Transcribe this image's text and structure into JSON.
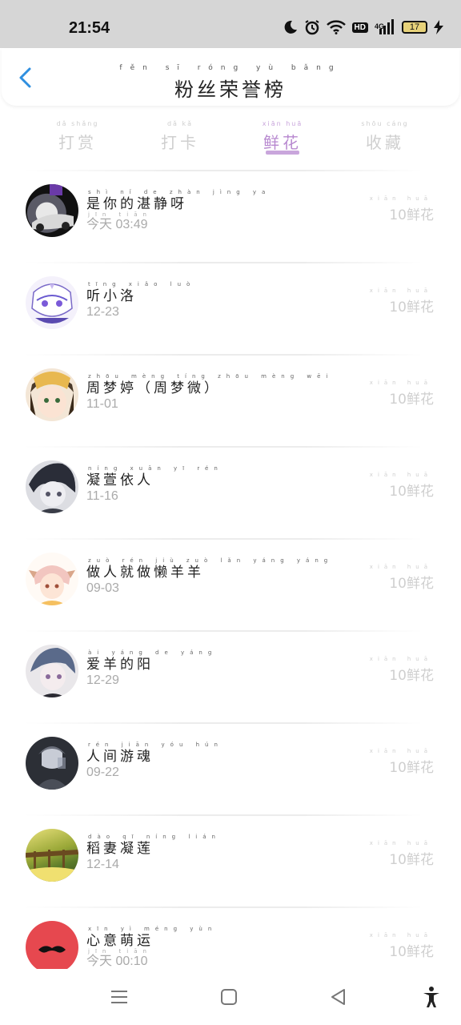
{
  "status_bar": {
    "time": "21:54",
    "battery": "17",
    "network": "4G",
    "hd": "HD",
    "icons": [
      "moon-icon",
      "alarm-icon",
      "wifi-icon",
      "hd-icon",
      "signal-icon",
      "battery-icon",
      "charging-icon"
    ]
  },
  "header": {
    "title": "粉丝荣誉榜",
    "title_pinyin": "fěn sī róng yù bǎng",
    "back_icon": "chevron-left-icon",
    "back_color": "#2f8fe0"
  },
  "tabs": [
    {
      "label": "打赏",
      "pinyin": "dǎ shǎng",
      "active": false
    },
    {
      "label": "打卡",
      "pinyin": "dǎ kǎ",
      "active": false
    },
    {
      "label": "鲜花",
      "pinyin": "xiān huā",
      "active": true
    },
    {
      "label": "收藏",
      "pinyin": "shōu cáng",
      "active": false
    }
  ],
  "colors": {
    "accent": "#c9a6dc",
    "muted": "#cfcfcf"
  },
  "gift_pinyin": "xiān huā",
  "rows": [
    {
      "name": "是你的湛静呀",
      "name_pinyin": "shì nǐ de zhàn jìng ya",
      "date": "今天 03:49",
      "date_pinyin": "jīn tiān",
      "gift": "10鲜花"
    },
    {
      "name": "听小洛",
      "name_pinyin": "tīng xiǎo luò",
      "date": "12-23",
      "date_pinyin": "",
      "gift": "10鲜花"
    },
    {
      "name": "周梦婷（周梦微）",
      "name_pinyin": "zhōu mèng tíng zhōu mèng wēi",
      "date": "11-01",
      "date_pinyin": "",
      "gift": "10鲜花"
    },
    {
      "name": "凝萱依人",
      "name_pinyin": "níng xuān yī rén",
      "date": "11-16",
      "date_pinyin": "",
      "gift": "10鲜花"
    },
    {
      "name": "做人就做懒羊羊",
      "name_pinyin": "zuò rén jiù zuò lǎn yáng yáng",
      "date": "09-03",
      "date_pinyin": "",
      "gift": "10鲜花"
    },
    {
      "name": "爱羊的阳",
      "name_pinyin": "ài yáng de yáng",
      "date": "12-29",
      "date_pinyin": "",
      "gift": "10鲜花"
    },
    {
      "name": "人间游魂",
      "name_pinyin": "rén jiān yóu hún",
      "date": "09-22",
      "date_pinyin": "",
      "gift": "10鲜花"
    },
    {
      "name": "稻妻凝莲",
      "name_pinyin": "dào qī níng lián",
      "date": "12-14",
      "date_pinyin": "",
      "gift": "10鲜花"
    },
    {
      "name": "心意萌运",
      "name_pinyin": "xīn yì méng yùn",
      "date": "今天 00:10",
      "date_pinyin": "jīn tiān",
      "gift": "10鲜花"
    }
  ],
  "nav": {
    "icons": [
      "menu-icon",
      "home-square-icon",
      "back-triangle-icon",
      "accessibility-icon"
    ]
  }
}
